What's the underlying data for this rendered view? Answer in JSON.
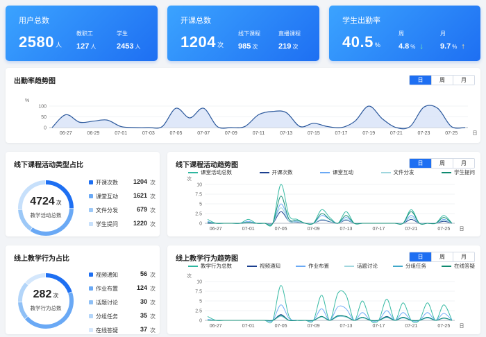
{
  "cards": {
    "users": {
      "title": "用户总数",
      "value": "2580",
      "unit": "人",
      "sub": [
        {
          "label": "教职工",
          "value": "127",
          "unit": "人"
        },
        {
          "label": "学生",
          "value": "2453",
          "unit": "人"
        }
      ]
    },
    "courses": {
      "title": "开课总数",
      "value": "1204",
      "unit": "次",
      "sub": [
        {
          "label": "线下课程",
          "value": "985",
          "unit": "次"
        },
        {
          "label": "直播课程",
          "value": "219",
          "unit": "次"
        }
      ]
    },
    "attendance": {
      "title": "学生出勤率",
      "value": "40.5",
      "unit": "%",
      "sub": [
        {
          "label": "周",
          "value": "4.8",
          "unit": "%",
          "arrow": "↓"
        },
        {
          "label": "月",
          "value": "9.7",
          "unit": "%",
          "arrow": "↑"
        }
      ]
    }
  },
  "segment_labels": [
    "日",
    "周",
    "月"
  ],
  "trend_panel": {
    "title": "出勤率趋势图",
    "x_unit": "日"
  },
  "offline_type_panel": {
    "title": "线下课程活动类型占比",
    "total": "4724",
    "total_unit": "次",
    "total_label": "教学活动总数",
    "items": [
      {
        "label": "开课次数",
        "value": "1204",
        "unit": "次",
        "color": "#1e6ff2"
      },
      {
        "label": "课堂互动",
        "value": "1621",
        "unit": "次",
        "color": "#6aa9f5"
      },
      {
        "label": "文件分发",
        "value": "679",
        "unit": "次",
        "color": "#9cc8f7"
      },
      {
        "label": "学生提问",
        "value": "1220",
        "unit": "次",
        "color": "#c7e0fb"
      }
    ]
  },
  "offline_trend_panel": {
    "title": "线下课程活动趋势图",
    "x_unit": "日"
  },
  "online_type_panel": {
    "title": "线上教学行为占比",
    "total": "282",
    "total_unit": "次",
    "total_label": "教学行为总数",
    "items": [
      {
        "label": "视频通知",
        "value": "56",
        "unit": "次",
        "color": "#1e6ff2"
      },
      {
        "label": "作业布置",
        "value": "124",
        "unit": "次",
        "color": "#6aa9f5"
      },
      {
        "label": "话题讨论",
        "value": "30",
        "unit": "次",
        "color": "#8fc0f6"
      },
      {
        "label": "分组任务",
        "value": "35",
        "unit": "次",
        "color": "#b3d5f9"
      },
      {
        "label": "在线答疑",
        "value": "37",
        "unit": "次",
        "color": "#d4e7fc"
      }
    ]
  },
  "online_trend_panel": {
    "title": "线上教学行为趋势图",
    "x_unit": "日"
  },
  "chart_data": [
    {
      "type": "area",
      "title": "出勤率趋势图",
      "ylabel": "%",
      "xlabel": "日",
      "ylim": [
        0,
        100
      ],
      "y_ticks": [
        "100",
        "50",
        "0"
      ],
      "x_tick_labels": [
        "06-27",
        "06-29",
        "07-01",
        "07-03",
        "07-05",
        "07-07",
        "07-09",
        "07-11",
        "07-13",
        "07-15",
        "07-17",
        "07-19",
        "07-21",
        "07-23",
        "07-25"
      ],
      "x": [
        "06-26",
        "06-27",
        "06-28",
        "06-29",
        "06-30",
        "07-01",
        "07-02",
        "07-03",
        "07-04",
        "07-05",
        "07-06",
        "07-07",
        "07-08",
        "07-09",
        "07-10",
        "07-11",
        "07-12",
        "07-13",
        "07-14",
        "07-15",
        "07-16",
        "07-17",
        "07-18",
        "07-19",
        "07-20",
        "07-21",
        "07-22",
        "07-23",
        "07-24",
        "07-25",
        "07-26"
      ],
      "series": [
        {
          "values": [
            0,
            60,
            25,
            30,
            35,
            5,
            0,
            0,
            5,
            90,
            45,
            90,
            5,
            0,
            5,
            60,
            75,
            70,
            5,
            20,
            5,
            0,
            30,
            100,
            40,
            0,
            5,
            95,
            90,
            5,
            0
          ]
        }
      ],
      "color": "#1f4e96",
      "fill": "#dbe6f8"
    },
    {
      "type": "line",
      "title": "线下课程活动趋势图",
      "ylabel": "次",
      "xlabel": "日",
      "ylim": [
        0,
        10
      ],
      "y_ticks": [
        "10",
        "7.5",
        "5",
        "2.5",
        "0"
      ],
      "x_tick_labels": [
        "06-27",
        "07-01",
        "07-05",
        "07-09",
        "07-13",
        "07-17",
        "07-21",
        "07-25"
      ],
      "x": [
        "06-26",
        "06-27",
        "06-28",
        "06-29",
        "06-30",
        "07-01",
        "07-02",
        "07-03",
        "07-04",
        "07-05",
        "07-06",
        "07-07",
        "07-08",
        "07-09",
        "07-10",
        "07-11",
        "07-12",
        "07-13",
        "07-14",
        "07-15",
        "07-16",
        "07-17",
        "07-18",
        "07-19",
        "07-20",
        "07-21",
        "07-22",
        "07-23",
        "07-24",
        "07-25",
        "07-26"
      ],
      "series": [
        {
          "name": "课堂活动总数",
          "color": "#2fb7a0",
          "values": [
            1,
            0,
            0,
            0,
            0,
            1,
            0,
            0,
            0,
            10.5,
            2,
            1,
            0,
            0,
            3.5,
            1.5,
            0,
            3,
            0,
            0,
            0,
            0,
            0,
            0,
            0,
            3.5,
            0,
            0,
            0,
            2,
            0
          ]
        },
        {
          "name": "开课次数",
          "color": "#1b3f8f",
          "values": [
            0,
            0,
            0,
            0,
            0,
            0.2,
            0,
            0,
            0,
            3,
            0.5,
            0.3,
            0,
            0,
            0.8,
            0.4,
            0,
            0.8,
            0,
            0,
            0,
            0,
            0,
            0,
            0,
            1,
            0,
            0,
            0,
            0.5,
            0
          ]
        },
        {
          "name": "课堂互动",
          "color": "#6aa9f5",
          "values": [
            0.5,
            0,
            0,
            0,
            0,
            0.5,
            0,
            0,
            0,
            5,
            1,
            0.5,
            0,
            0,
            2,
            1,
            0,
            1.5,
            0,
            0,
            0,
            0,
            0,
            0,
            0,
            2,
            0,
            0,
            0,
            1,
            0
          ]
        },
        {
          "name": "文件分发",
          "color": "#9fd6de",
          "values": [
            0.3,
            0,
            0,
            0,
            0,
            0.3,
            0,
            0,
            0,
            4,
            0.5,
            0.4,
            0,
            0,
            1,
            0.5,
            0,
            1,
            0,
            0,
            0,
            0,
            0,
            0,
            0,
            1.5,
            0,
            0,
            0,
            0.8,
            0
          ]
        },
        {
          "name": "学生提问",
          "color": "#0f8a70",
          "values": [
            0.2,
            0,
            0,
            0,
            0,
            0.2,
            0,
            0,
            0,
            7,
            1,
            0.8,
            0,
            0,
            2.5,
            1,
            0,
            2,
            0,
            0,
            0,
            0,
            0,
            0,
            0,
            3,
            0,
            0,
            0,
            1.5,
            0
          ]
        }
      ]
    },
    {
      "type": "line",
      "title": "线上教学行为趋势图",
      "ylabel": "次",
      "xlabel": "日",
      "ylim": [
        0,
        10
      ],
      "y_ticks": [
        "10",
        "7.5",
        "5",
        "2.5",
        "0"
      ],
      "x_tick_labels": [
        "06-27",
        "07-01",
        "07-05",
        "07-09",
        "07-13",
        "07-17",
        "07-21",
        "07-25"
      ],
      "x": [
        "06-26",
        "06-27",
        "06-28",
        "06-29",
        "06-30",
        "07-01",
        "07-02",
        "07-03",
        "07-04",
        "07-05",
        "07-06",
        "07-07",
        "07-08",
        "07-09",
        "07-10",
        "07-11",
        "07-12",
        "07-13",
        "07-14",
        "07-15",
        "07-16",
        "07-17",
        "07-18",
        "07-19",
        "07-20",
        "07-21",
        "07-22",
        "07-23",
        "07-24",
        "07-25",
        "07-26"
      ],
      "series": [
        {
          "name": "教学行为总数",
          "color": "#2fb7a0",
          "values": [
            1,
            0,
            0,
            0,
            0,
            0,
            0,
            0,
            0,
            9,
            1,
            0,
            0,
            0,
            6.5,
            0,
            7,
            6.5,
            0,
            5,
            0,
            0,
            5.5,
            0,
            4.5,
            0,
            0,
            4.5,
            0,
            4,
            0
          ]
        },
        {
          "name": "视频通知",
          "color": "#1b3f8f",
          "values": [
            0,
            0,
            0,
            0,
            0,
            0,
            0,
            0,
            0,
            1.5,
            0,
            0,
            0,
            0,
            1,
            0,
            1.2,
            1,
            0,
            0.8,
            0,
            0,
            1,
            0,
            0.8,
            0,
            0,
            0.8,
            0,
            0.6,
            0
          ]
        },
        {
          "name": "作业布置",
          "color": "#6aa9f5",
          "values": [
            0.3,
            0,
            0,
            0,
            0,
            0,
            0,
            0,
            0,
            4,
            0.5,
            0,
            0,
            0,
            3,
            0,
            3.5,
            3,
            0,
            2,
            0,
            0,
            2.5,
            0,
            2,
            0,
            0,
            2,
            0,
            1.8,
            0
          ]
        },
        {
          "name": "话题讨论",
          "color": "#9fd6de",
          "values": [
            0,
            0,
            0,
            0,
            0,
            0,
            0,
            0,
            0,
            1,
            0,
            0,
            0,
            0,
            0.8,
            0,
            1,
            0.8,
            0,
            0.6,
            0,
            0,
            0.7,
            0,
            0.6,
            0,
            0,
            0.6,
            0,
            0.5,
            0
          ]
        },
        {
          "name": "分组任务",
          "color": "#3fa8c9",
          "values": [
            0,
            0,
            0,
            0,
            0,
            0,
            0,
            0,
            0,
            1.2,
            0,
            0,
            0,
            0,
            1,
            0,
            1,
            1,
            0,
            0.8,
            0,
            0,
            0.8,
            0,
            0.7,
            0,
            0,
            0.7,
            0,
            0.6,
            0
          ]
        },
        {
          "name": "在线答疑",
          "color": "#0f8a70",
          "values": [
            0,
            0,
            0,
            0,
            0,
            0,
            0,
            0,
            0,
            1.3,
            0,
            0,
            0,
            0,
            1,
            0,
            1.2,
            1,
            0,
            0.8,
            0,
            0,
            0.9,
            0,
            0.8,
            0,
            0,
            0.8,
            0,
            0.6,
            0
          ]
        }
      ]
    }
  ]
}
